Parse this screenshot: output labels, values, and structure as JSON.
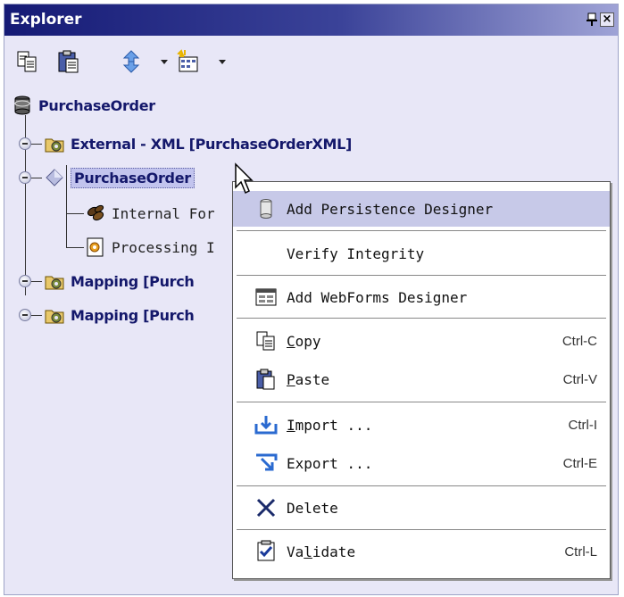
{
  "window": {
    "title": "Explorer"
  },
  "toolbar": {
    "copy_icon": "copy-icon",
    "paste_icon": "paste-icon",
    "sync_icon": "refresh-arrows-icon",
    "new_icon": "new-item-icon"
  },
  "tree": {
    "root": {
      "label": "PurchaseOrder",
      "icon": "database-icon"
    },
    "items": [
      {
        "label": "External - XML [PurchaseOrderXML]",
        "icon": "folder-gear-icon"
      },
      {
        "label": "PurchaseOrder",
        "icon": "diamond-icon",
        "selected": true
      },
      {
        "label": "Internal For",
        "icon": "beans-icon"
      },
      {
        "label": "Processing I",
        "icon": "process-document-icon"
      },
      {
        "label": "Mapping [Purch",
        "icon": "folder-gear-icon"
      },
      {
        "label": "Mapping [Purch",
        "icon": "folder-gear-icon"
      }
    ]
  },
  "context_menu": {
    "items": [
      {
        "label": "Add Persistence Designer",
        "icon": "cylinder-icon",
        "highlighted": true
      },
      {
        "label": "Verify Integrity"
      },
      {
        "label": "Add WebForms Designer",
        "icon": "form-icon"
      },
      {
        "label_pre": "",
        "label_u": "C",
        "label_post": "opy",
        "shortcut": "Ctrl-C",
        "icon": "copy-icon"
      },
      {
        "label_pre": "",
        "label_u": "P",
        "label_post": "aste",
        "shortcut": "Ctrl-V",
        "icon": "paste-icon"
      },
      {
        "label_pre": "",
        "label_u": "I",
        "label_post": "mport ...",
        "shortcut": "Ctrl-I",
        "icon": "import-icon"
      },
      {
        "label": "Export ...",
        "shortcut": "Ctrl-E",
        "icon": "export-icon"
      },
      {
        "label": "Delete",
        "icon": "delete-x-icon"
      },
      {
        "label_pre": "Va",
        "label_u": "l",
        "label_post": "idate",
        "shortcut": "Ctrl-L",
        "icon": "validate-icon"
      }
    ]
  },
  "colors": {
    "title_bar": "#151a75",
    "panel_bg": "#e8e7f7",
    "menu_highlight": "#c7c9e8",
    "tree_text": "#14186b"
  }
}
